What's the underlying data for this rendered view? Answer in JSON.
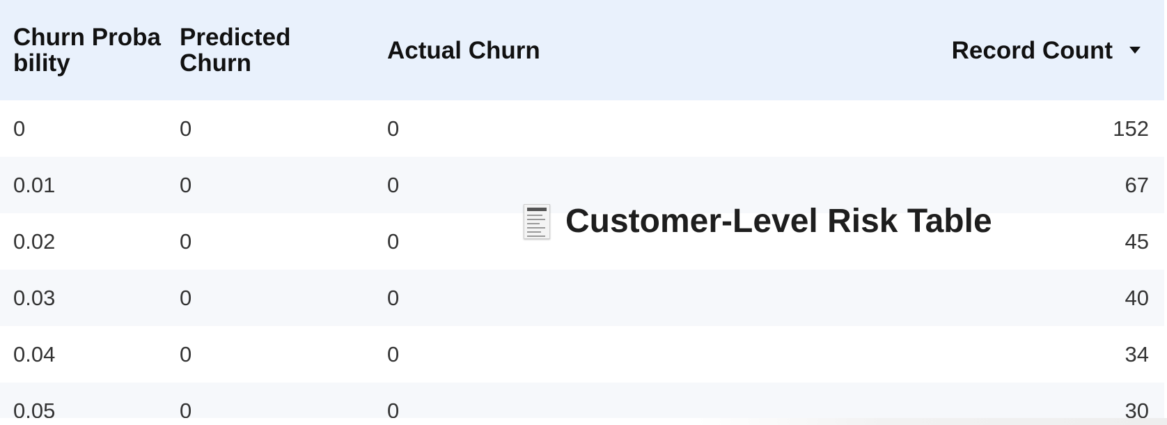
{
  "table": {
    "columns": [
      {
        "label": "Churn Probability"
      },
      {
        "label": "Predicted Churn"
      },
      {
        "label": "Actual Churn"
      },
      {
        "label": "Record Count",
        "sorted": "descending",
        "icon": "sort-desc-icon"
      }
    ],
    "rows": [
      {
        "churn_probability": "0",
        "predicted_churn": "0",
        "actual_churn": "0",
        "record_count": "152"
      },
      {
        "churn_probability": "0.01",
        "predicted_churn": "0",
        "actual_churn": "0",
        "record_count": "67"
      },
      {
        "churn_probability": "0.02",
        "predicted_churn": "0",
        "actual_churn": "0",
        "record_count": "45"
      },
      {
        "churn_probability": "0.03",
        "predicted_churn": "0",
        "actual_churn": "0",
        "record_count": "40"
      },
      {
        "churn_probability": "0.04",
        "predicted_churn": "0",
        "actual_churn": "0",
        "record_count": "34"
      },
      {
        "churn_probability": "0.05",
        "predicted_churn": "0",
        "actual_churn": "0",
        "record_count": "30"
      }
    ]
  },
  "overlay": {
    "title": "Customer-Level Risk Table",
    "icon": "receipt-icon"
  },
  "colors": {
    "header_bg": "#e9f1fc",
    "alt_row_bg": "#f6f8fb",
    "text": "#333333",
    "header_text": "#111111"
  }
}
